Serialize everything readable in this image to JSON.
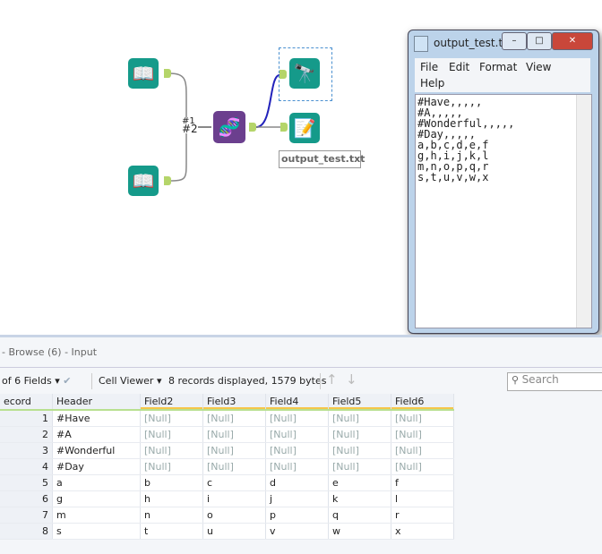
{
  "canvas": {
    "connection_labels": [
      "#1",
      "#2"
    ],
    "output_label": "output_test.txt"
  },
  "notepad": {
    "title": "output_test.t...",
    "menu": [
      "File",
      "Edit",
      "Format",
      "View",
      "Help"
    ],
    "lines": [
      "#Have,,,,,",
      "#A,,,,,",
      "#Wonderful,,,,,",
      "#Day,,,,,",
      "a,b,c,d,e,f",
      "g,h,i,j,k,l",
      "m,n,o,p,q,r",
      "s,t,u,v,w,x"
    ]
  },
  "results": {
    "title": "- Browse (6) - Input",
    "fields_selector": "of 6 Fields",
    "cell_viewer": "Cell Viewer",
    "records_info": "8 records displayed, 1579 bytes",
    "search_placeholder": "Search"
  },
  "table": {
    "columns": [
      "ecord",
      "Header",
      "Field2",
      "Field3",
      "Field4",
      "Field5",
      "Field6"
    ],
    "rows": [
      [
        "1",
        "#Have",
        "[Null]",
        "[Null]",
        "[Null]",
        "[Null]",
        "[Null]"
      ],
      [
        "2",
        "#A",
        "[Null]",
        "[Null]",
        "[Null]",
        "[Null]",
        "[Null]"
      ],
      [
        "3",
        "#Wonderful",
        "[Null]",
        "[Null]",
        "[Null]",
        "[Null]",
        "[Null]"
      ],
      [
        "4",
        "#Day",
        "[Null]",
        "[Null]",
        "[Null]",
        "[Null]",
        "[Null]"
      ],
      [
        "5",
        "a",
        "b",
        "c",
        "d",
        "e",
        "f"
      ],
      [
        "6",
        "g",
        "h",
        "i",
        "j",
        "k",
        "l"
      ],
      [
        "7",
        "m",
        "n",
        "o",
        "p",
        "q",
        "r"
      ],
      [
        "8",
        "s",
        "t",
        "u",
        "v",
        "w",
        "x"
      ]
    ]
  }
}
